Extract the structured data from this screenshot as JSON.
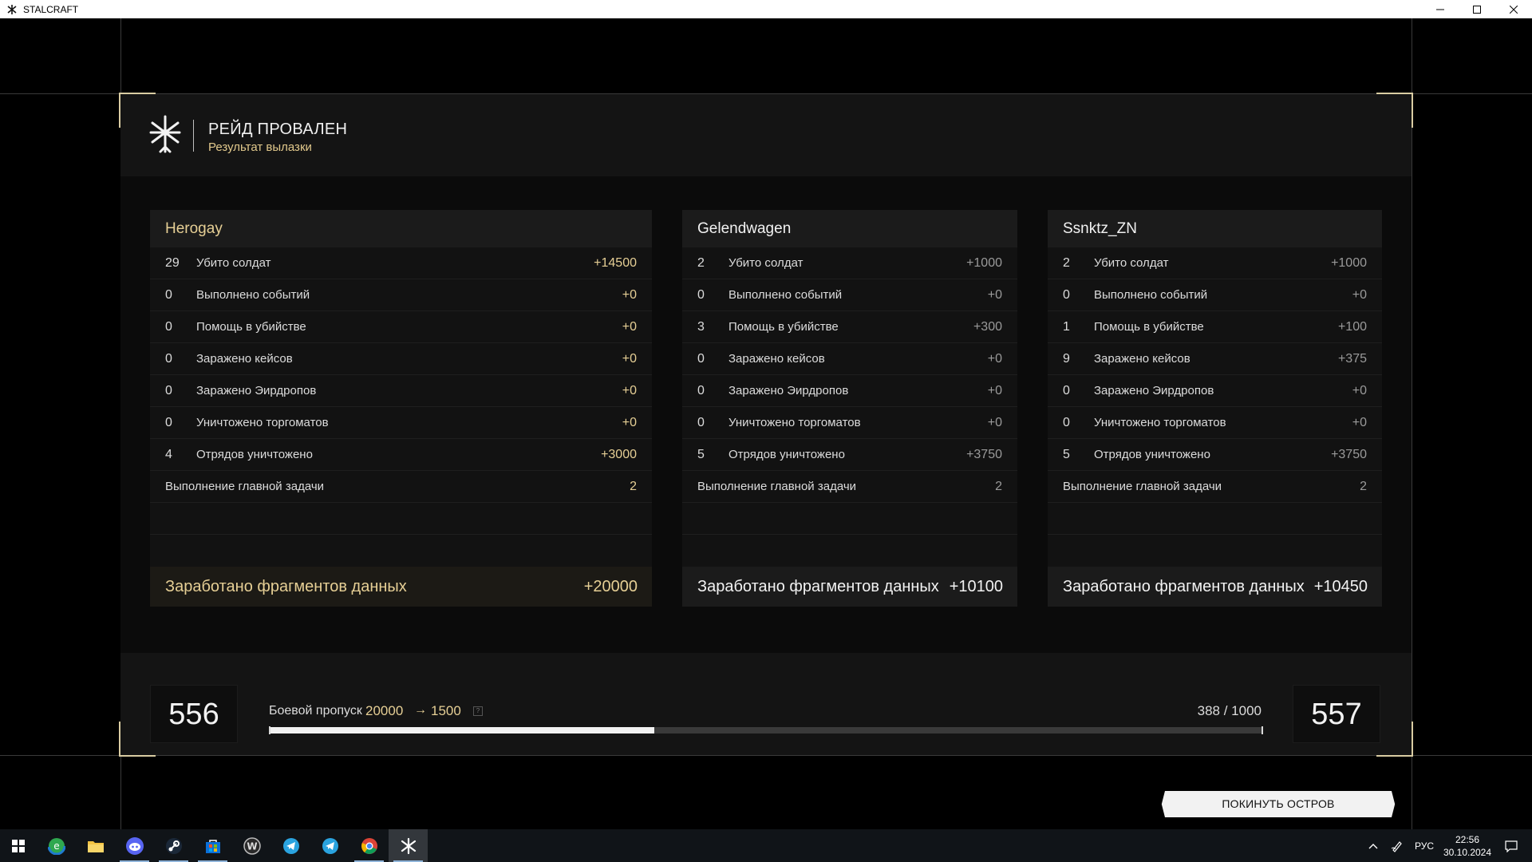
{
  "window": {
    "title": "STALCRAFT"
  },
  "header": {
    "title": "РЕЙД ПРОВАЛЕН",
    "subtitle": "Результат вылазки"
  },
  "players": [
    {
      "name": "Herogay",
      "rows": [
        {
          "count": "29",
          "label": "Убито солдат",
          "value": "+14500"
        },
        {
          "count": "0",
          "label": "Выполнено событий",
          "value": "+0"
        },
        {
          "count": "0",
          "label": "Помощь в убийстве",
          "value": "+0"
        },
        {
          "count": "0",
          "label": "Заражено кейсов",
          "value": "+0"
        },
        {
          "count": "0",
          "label": "Заражено Эирдропов",
          "value": "+0"
        },
        {
          "count": "0",
          "label": "Уничтожено торгоматов",
          "value": "+0"
        },
        {
          "count": "4",
          "label": "Отрядов уничтожено",
          "value": "+3000"
        }
      ],
      "main_task": {
        "label": "Выполнение главной задачи",
        "value": "2"
      },
      "total": {
        "label": "Заработано фрагментов данных",
        "value": "+20000"
      }
    },
    {
      "name": "Gelendwagen",
      "rows": [
        {
          "count": "2",
          "label": "Убито солдат",
          "value": "+1000"
        },
        {
          "count": "0",
          "label": "Выполнено событий",
          "value": "+0"
        },
        {
          "count": "3",
          "label": "Помощь в убийстве",
          "value": "+300"
        },
        {
          "count": "0",
          "label": "Заражено кейсов",
          "value": "+0"
        },
        {
          "count": "0",
          "label": "Заражено Эирдропов",
          "value": "+0"
        },
        {
          "count": "0",
          "label": "Уничтожено торгоматов",
          "value": "+0"
        },
        {
          "count": "5",
          "label": "Отрядов уничтожено",
          "value": "+3750"
        }
      ],
      "main_task": {
        "label": "Выполнение главной задачи",
        "value": "2"
      },
      "total": {
        "label": "Заработано фрагментов данных",
        "value": "+10100"
      }
    },
    {
      "name": "Ssnktz_ZN",
      "rows": [
        {
          "count": "2",
          "label": "Убито солдат",
          "value": "+1000"
        },
        {
          "count": "0",
          "label": "Выполнено событий",
          "value": "+0"
        },
        {
          "count": "1",
          "label": "Помощь в убийстве",
          "value": "+100"
        },
        {
          "count": "9",
          "label": "Заражено кейсов",
          "value": "+375"
        },
        {
          "count": "0",
          "label": "Заражено Эирдропов",
          "value": "+0"
        },
        {
          "count": "0",
          "label": "Уничтожено торгоматов",
          "value": "+0"
        },
        {
          "count": "5",
          "label": "Отрядов уничтожено",
          "value": "+3750"
        }
      ],
      "main_task": {
        "label": "Выполнение главной задачи",
        "value": "2"
      },
      "total": {
        "label": "Заработано фрагментов данных",
        "value": "+10450"
      }
    }
  ],
  "battlepass": {
    "label": "Боевой пропуск",
    "from": "20000",
    "arrow": "→",
    "to": "1500",
    "progress_text": "388 / 1000",
    "progress_fraction": 0.388,
    "current_level": "556",
    "next_level": "557"
  },
  "actions": {
    "leave_label": "ПОКИНУТЬ ОСТРОВ"
  },
  "taskbar": {
    "apps": [
      "edge-icon",
      "file-explorer-icon",
      "discord-icon",
      "steam-icon",
      "store-icon",
      "wargaming-icon",
      "telegram-icon",
      "telegram-icon",
      "chrome-icon",
      "stalcraft-icon"
    ],
    "language": "РУС",
    "time": "22:56",
    "date": "30.10.2024"
  },
  "colors": {
    "accent_gold": "#e6cf95",
    "panel_bg": "#0b0b0b",
    "frame_corner": "#d9cca2"
  }
}
